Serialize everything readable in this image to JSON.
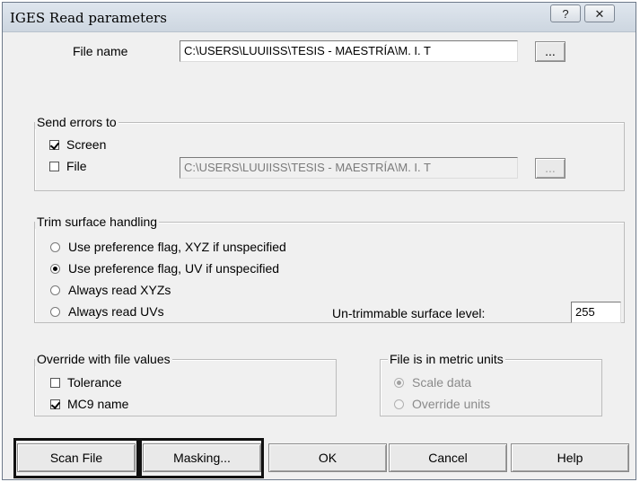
{
  "window": {
    "title": "IGES Read parameters",
    "help_glyph": "?",
    "close_glyph": "✕"
  },
  "file_name": {
    "label": "File name",
    "value": "C:\\USERS\\LUUIISS\\TESIS - MAESTRÍA\\M. I. T",
    "browse_label": "..."
  },
  "send_errors": {
    "legend": "Send errors to",
    "screen": {
      "label": "Screen",
      "checked": true
    },
    "file": {
      "label": "File",
      "checked": false
    },
    "file_path": "C:\\USERS\\LUUIISS\\TESIS - MAESTRÍA\\M. I. T",
    "browse_label": "..."
  },
  "trim": {
    "legend": "Trim surface handling",
    "options": [
      {
        "label": "Use preference flag, XYZ if unspecified",
        "selected": false
      },
      {
        "label": "Use preference flag, UV if unspecified",
        "selected": true
      },
      {
        "label": "Always read XYZs",
        "selected": false
      },
      {
        "label": "Always read UVs",
        "selected": false
      }
    ],
    "untrimmable_label": "Un-trimmable surface level:",
    "untrimmable_value": "255"
  },
  "override": {
    "legend": "Override with file values",
    "tolerance": {
      "label": "Tolerance",
      "checked": false
    },
    "mc9": {
      "label": "MC9 name",
      "checked": true
    }
  },
  "metric": {
    "legend": "File is in metric units",
    "scale": {
      "label": "Scale data",
      "selected": true
    },
    "override_units": {
      "label": "Override units",
      "selected": false
    }
  },
  "buttons": {
    "scan_file": "Scan File",
    "masking": "Masking...",
    "ok": "OK",
    "cancel": "Cancel",
    "help": "Help"
  }
}
